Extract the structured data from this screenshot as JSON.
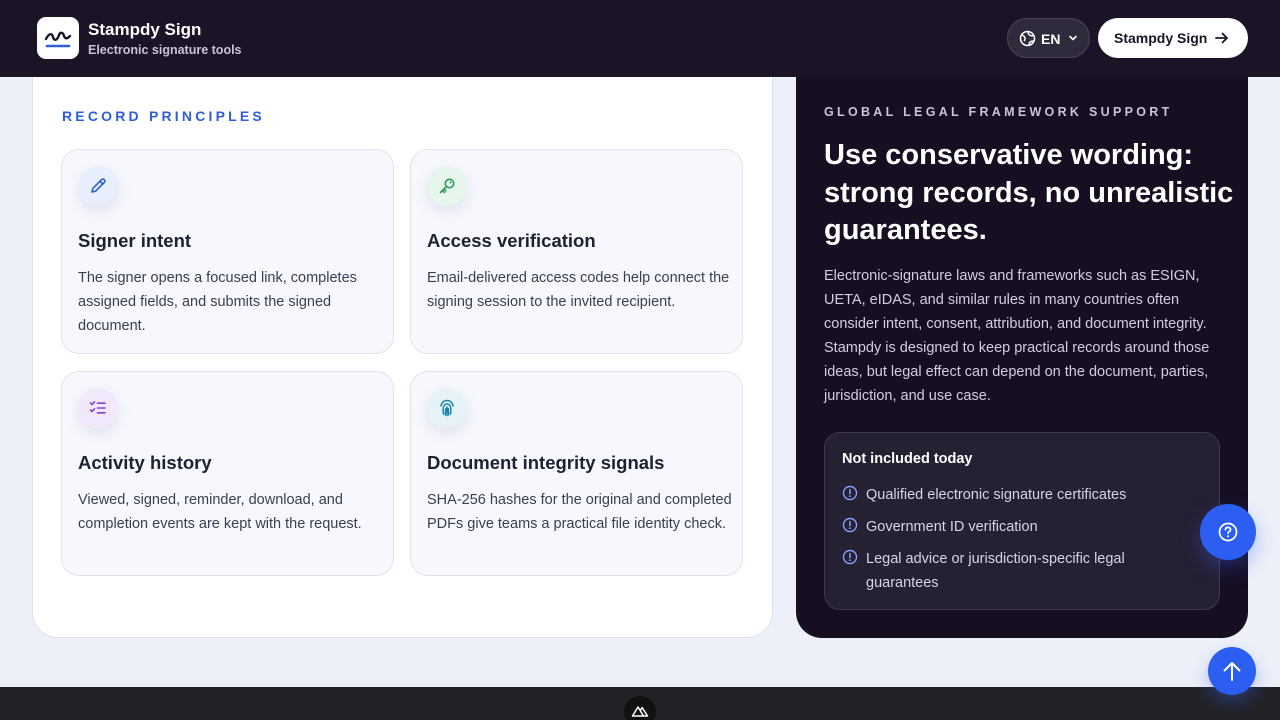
{
  "header": {
    "brand_name": "Stampdy Sign",
    "brand_tagline": "Electronic signature tools",
    "language": "EN",
    "cta_label": "Stampdy Sign"
  },
  "principles": {
    "eyebrow": "RECORD PRINCIPLES",
    "items": [
      {
        "icon": "pen-icon",
        "title": "Signer intent",
        "text": "The signer opens a focused link, completes assigned fields, and submits the signed document."
      },
      {
        "icon": "key-icon",
        "title": "Access verification",
        "text": "Email-delivered access codes help connect the signing session to the invited recipient."
      },
      {
        "icon": "checklist-icon",
        "title": "Activity history",
        "text": "Viewed, signed, reminder, download, and completion events are kept with the request."
      },
      {
        "icon": "fingerprint-icon",
        "title": "Document integrity signals",
        "text": "SHA-256 hashes for the original and completed PDFs give teams a practical file identity check."
      }
    ]
  },
  "legal": {
    "eyebrow": "GLOBAL LEGAL FRAMEWORK SUPPORT",
    "title": "Use conservative wording: strong records, no unrealistic guarantees.",
    "body": "Electronic-signature laws and frameworks such as ESIGN, UETA, eIDAS, and similar rules in many countries often consider intent, consent, attribution, and document integrity. Stampdy is designed to keep practical records around those ideas, but legal effect can depend on the document, parties, jurisdiction, and use case.",
    "excluded_title": "Not included today",
    "excluded_items": [
      "Qualified electronic signature certificates",
      "Government ID verification",
      "Legal advice or jurisdiction-specific legal guarantees"
    ]
  },
  "colors": {
    "header_bg": "#1c1327",
    "accent_blue": "#2d5ef2",
    "eyebrow_blue": "#2f5fd6",
    "dark_card": "#170e22"
  }
}
